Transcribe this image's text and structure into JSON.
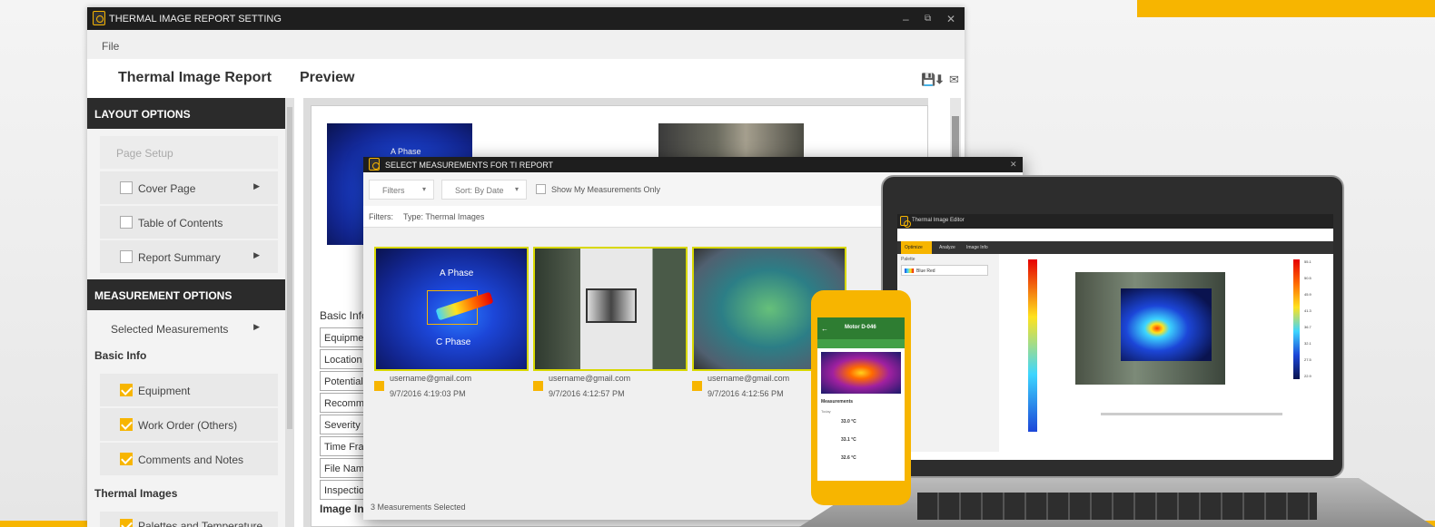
{
  "main_window": {
    "title": "THERMAL IMAGE REPORT SETTING",
    "minimize": "–",
    "restore": "⧉",
    "close": "✕",
    "menu_file": "File",
    "heading_report": "Thermal Image Report",
    "heading_preview": "Preview",
    "toolbar_icons": [
      "save-icon",
      "download-icon",
      "mail-icon"
    ]
  },
  "sidebar": {
    "layout_header": "LAYOUT OPTIONS",
    "page_setup": "Page Setup",
    "cover_page": "Cover Page",
    "table_of_contents": "Table of Contents",
    "report_summary": "Report Summary",
    "measurement_header": "MEASUREMENT OPTIONS",
    "selected_measurements": "Selected Measurements",
    "basic_info": "Basic Info",
    "equipment": "Equipment",
    "work_order": "Work Order (Others)",
    "comments": "Comments and Notes",
    "thermal_images": "Thermal Images",
    "palette": "Palettes and Temperature scale"
  },
  "preview": {
    "a_phase": "A Phase",
    "basic_info_label": "Basic Info:",
    "fields": [
      "Equipment",
      "Location",
      "Potential",
      "Recomme",
      "Severity",
      "Time Fram",
      "File Name",
      "Inspection"
    ],
    "image_info": "Image In"
  },
  "dialog": {
    "title": "SELECT MEASUREMENTS FOR TI REPORT",
    "close": "✕",
    "filters_btn": "Filters",
    "sort_btn": "Sort: By Date",
    "show_mine": "Show My Measurements Only",
    "filters_label": "Filters:",
    "filter_type": "Type: Thermal Images",
    "tiles": [
      {
        "user": "username@gmail.com",
        "date": "9/7/2016 4:19:03 PM",
        "label_a": "A Phase",
        "label_c": "C Phase"
      },
      {
        "user": "username@gmail.com",
        "date": "9/7/2016 4:12:57 PM"
      },
      {
        "user": "username@gmail.com",
        "date": "9/7/2016 4:12:56 PM"
      }
    ],
    "status": "3 Measurements Selected"
  },
  "laptop": {
    "app_title": "Thermal Image Editor",
    "tabs": [
      "Optimize",
      "Analyze",
      "Image Info"
    ],
    "scale_values": [
      "55.1",
      "50.5",
      "45.9",
      "41.3",
      "36.7",
      "32.1",
      "27.5",
      "22.9"
    ],
    "palette_label": "Palette",
    "palette_value": "Blue Red"
  },
  "phone": {
    "title": "Motor D-046",
    "measurements_label": "Measurements",
    "today": "Today",
    "readings": [
      "33.0 °C",
      "33.1 °C",
      "32.6 °C"
    ]
  },
  "colors": {
    "accent": "#f7b500",
    "titlebar": "#1e1e1e",
    "section_header": "#2b2b2b"
  }
}
